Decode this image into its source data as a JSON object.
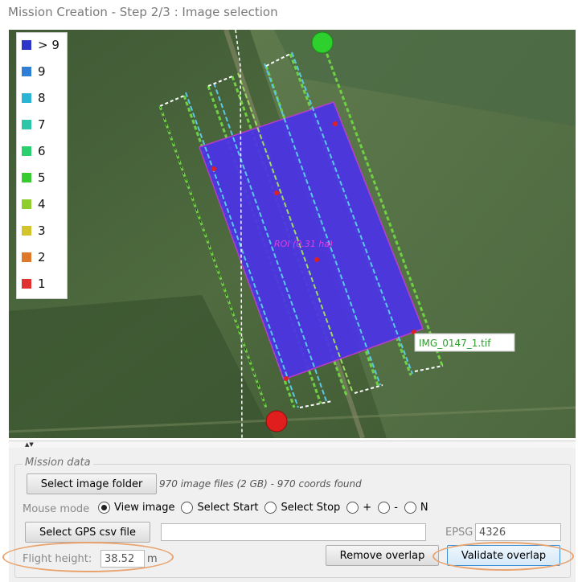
{
  "window": {
    "title": "Mission Creation - Step 2/3 : Image selection"
  },
  "legend": {
    "items": [
      {
        "label": "> 9",
        "color": "#2e35c9"
      },
      {
        "label": "9",
        "color": "#2f7fd6"
      },
      {
        "label": "8",
        "color": "#2bb5d4"
      },
      {
        "label": "7",
        "color": "#2dc7a8"
      },
      {
        "label": "6",
        "color": "#2ccf6e"
      },
      {
        "label": "5",
        "color": "#36cc2f"
      },
      {
        "label": "4",
        "color": "#8fcf2d"
      },
      {
        "label": "3",
        "color": "#d4c42b"
      },
      {
        "label": "2",
        "color": "#e0782a"
      },
      {
        "label": "1",
        "color": "#e03030"
      }
    ]
  },
  "map": {
    "roi_label": "ROI (0.31 ha)",
    "image_tooltip": "IMG_0147_1.tif",
    "start_marker_color": "#2ed02e",
    "stop_marker_color": "#e01e1e"
  },
  "mission": {
    "group_label": "Mission data",
    "select_folder_label": "Select image folder",
    "folder_info": "970 image files (2 GB) - 970 coords found",
    "mouse_mode_label": "Mouse mode",
    "mouse_modes": [
      {
        "label": "View image",
        "selected": true
      },
      {
        "label": "Select Start",
        "selected": false
      },
      {
        "label": "Select Stop",
        "selected": false
      },
      {
        "label": "+",
        "selected": false
      },
      {
        "label": "-",
        "selected": false
      },
      {
        "label": "N",
        "selected": false
      }
    ],
    "select_gps_label": "Select GPS csv file",
    "gps_path_value": "",
    "epsg_label": "EPSG",
    "epsg_value": "4326",
    "flight_height_label": "Flight height:",
    "flight_height_value": "38.52",
    "flight_height_unit": "m",
    "remove_overlap_label": "Remove overlap",
    "validate_overlap_label": "Validate overlap"
  }
}
